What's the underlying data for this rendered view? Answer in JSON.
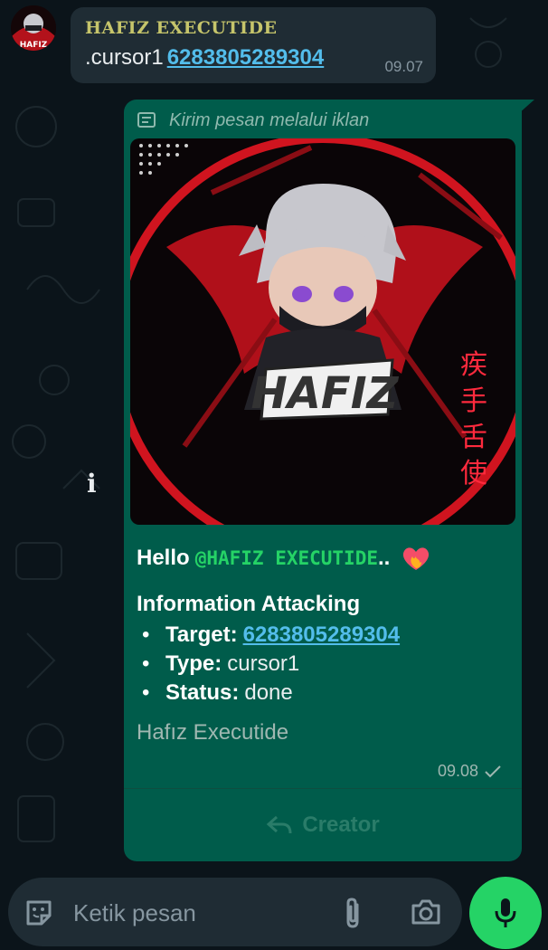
{
  "incoming": {
    "sender": "HAFIZ EXECUTIDE",
    "text": ".cursor1",
    "number": "6283805289304",
    "time": "09.07",
    "avatar_text": "HAFIZ"
  },
  "outgoing": {
    "ad_label": "Kirim pesan melalui iklan",
    "banner_text": "HAFIZ",
    "hello": "Hello",
    "mention": "@HAFIZ EXECUTIDE",
    "mention_suffix": "..",
    "emoji": "heart-on-fire",
    "info_title": "Information Attacking",
    "items": [
      {
        "key": "Target:",
        "value": "6283805289304"
      },
      {
        "key": "Type:",
        "value": "cursor1"
      },
      {
        "key": "Status:",
        "value": "done"
      }
    ],
    "footer": "Hafız Executide",
    "time": "09.08",
    "button_label": "Creator"
  },
  "input": {
    "placeholder": "Ketik pesan"
  },
  "colors": {
    "background": "#0b141a",
    "incoming_bubble": "#1f2c34",
    "outgoing_bubble": "#005c4b",
    "accent_green": "#25d366",
    "link_blue": "#53bdeb",
    "sender_yellow": "#c6c56b"
  }
}
